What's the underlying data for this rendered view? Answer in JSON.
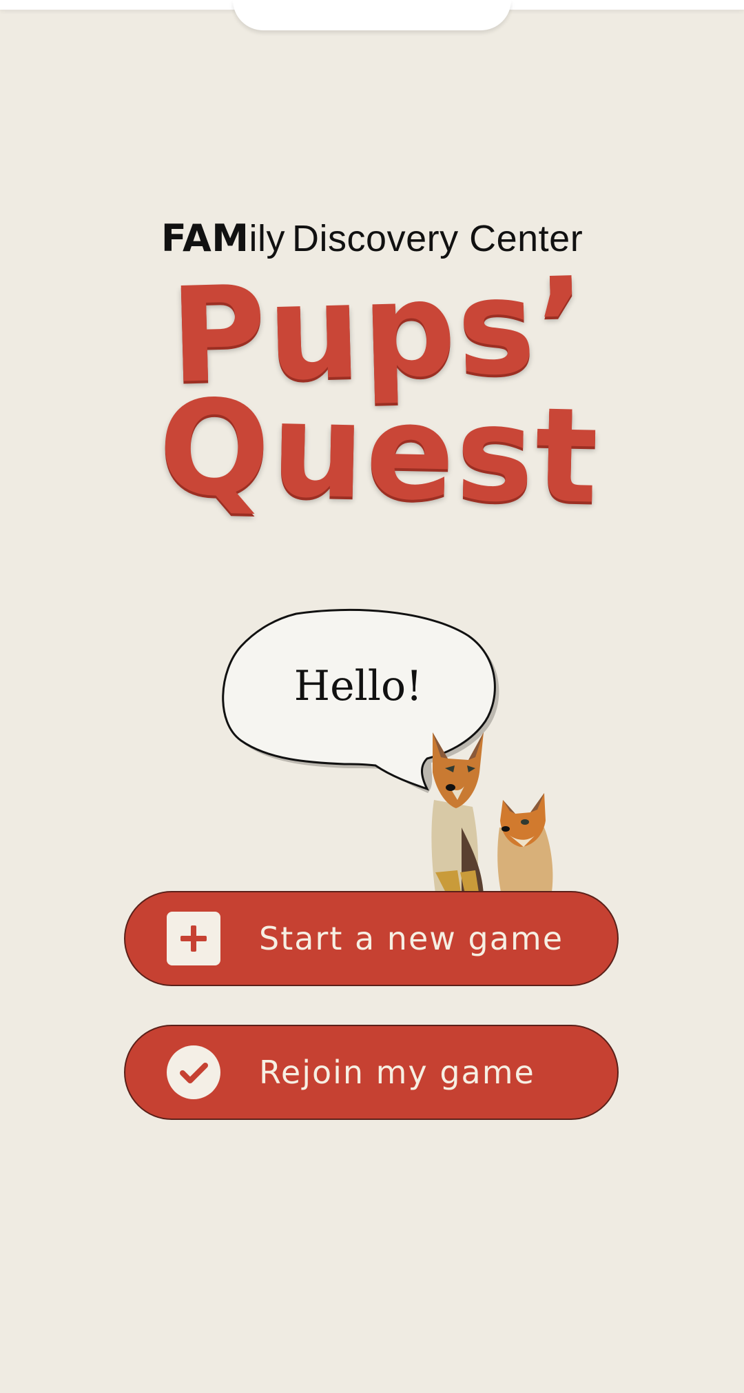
{
  "org_logo": {
    "fam": "FAM",
    "ily": "ily",
    "rest": "Discovery Center"
  },
  "title": {
    "line1": "Pups’",
    "line2": "Quest"
  },
  "speech_bubble": {
    "text": "Hello!"
  },
  "buttons": {
    "start_label": "Start a new game",
    "rejoin_label": "Rejoin my game"
  },
  "icons": {
    "start_icon": "plus-icon",
    "rejoin_icon": "check-icon",
    "mascot": "pups-illustration"
  },
  "colors": {
    "background": "#efebe2",
    "accent": "#c64132",
    "button_text": "#f6efe3"
  }
}
